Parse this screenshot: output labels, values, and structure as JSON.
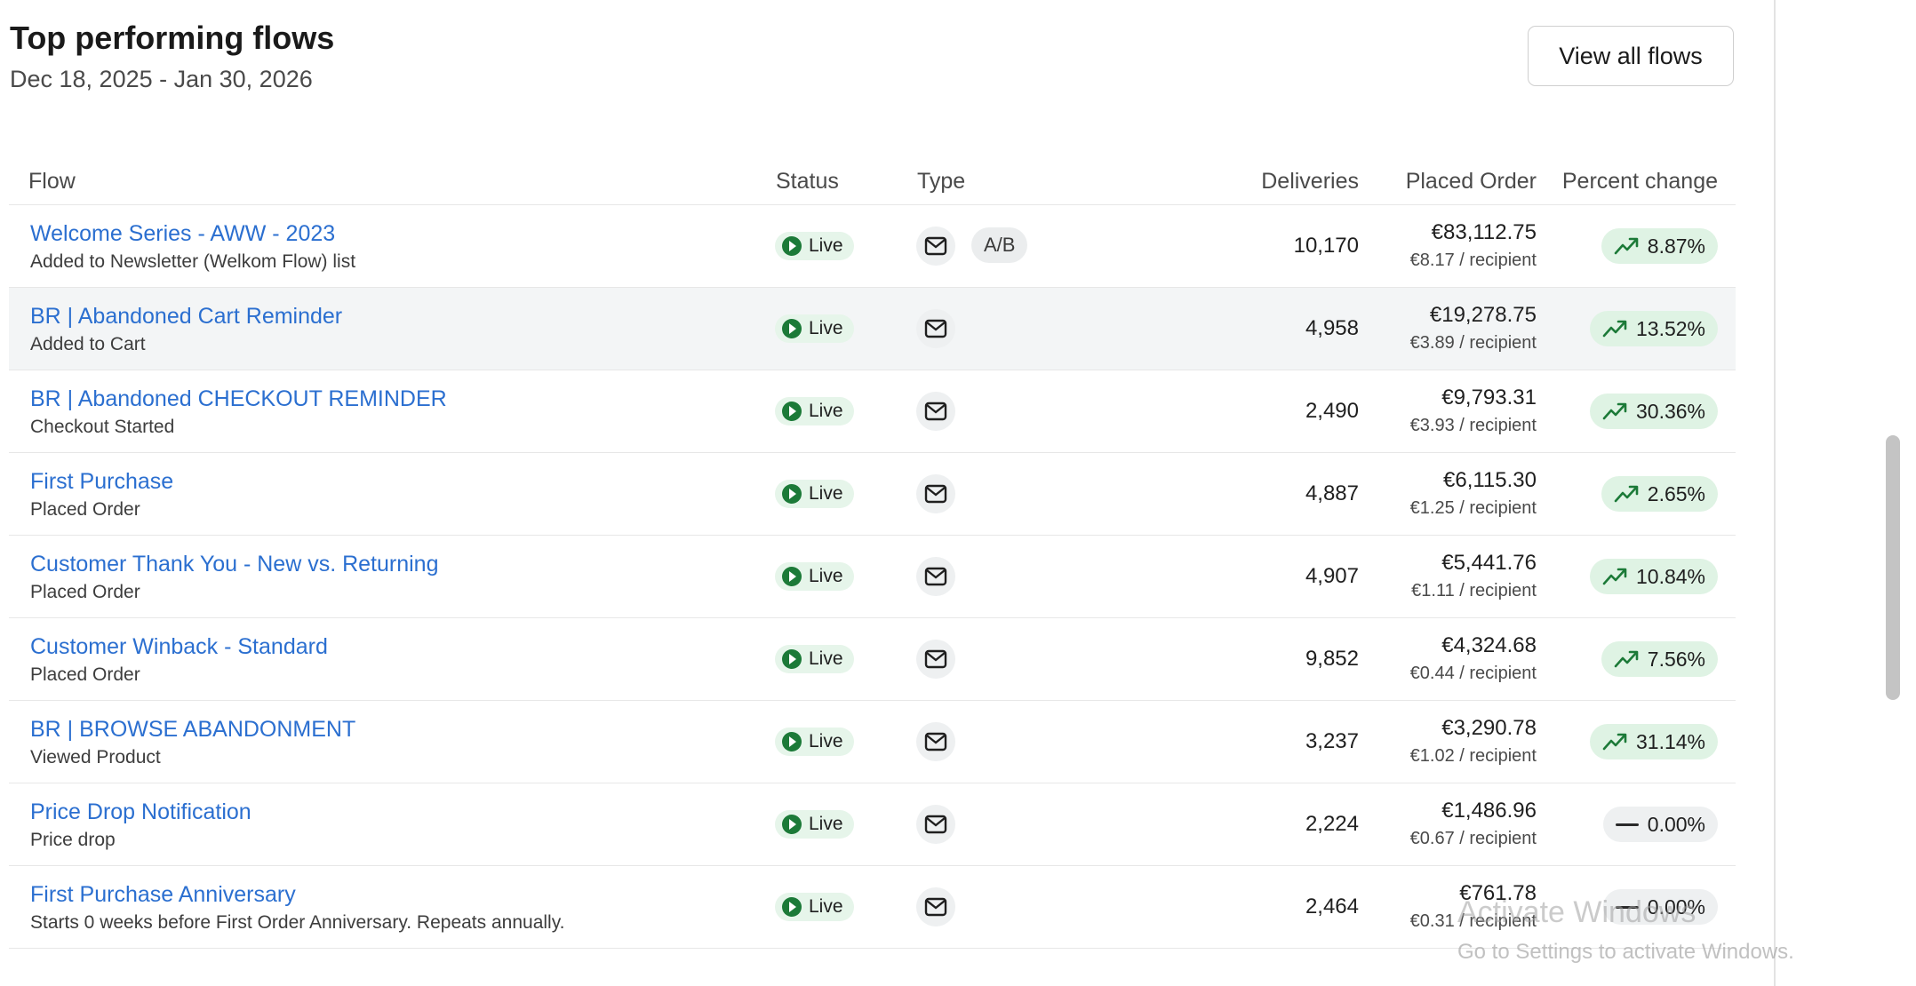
{
  "header": {
    "title": "Top performing flows",
    "date_range": "Dec 18, 2025 - Jan 30, 2026",
    "view_all_label": "View all flows"
  },
  "columns": {
    "flow": "Flow",
    "status": "Status",
    "type": "Type",
    "deliveries": "Deliveries",
    "placed_order": "Placed Order",
    "percent_change": "Percent change"
  },
  "rows": [
    {
      "name": "Welcome Series - AWW - 2023",
      "trigger": "Added to Newsletter (Welkom Flow) list",
      "status": "Live",
      "type_icon": "mail-icon",
      "ab": "A/B",
      "deliveries": "10,170",
      "placed": "€83,112.75",
      "per_recipient": "€8.17 / recipient",
      "change": "8.87%",
      "trend": "up"
    },
    {
      "name": "BR | Abandoned Cart Reminder",
      "trigger": "Added to Cart",
      "status": "Live",
      "type_icon": "mail-icon",
      "ab": "",
      "deliveries": "4,958",
      "placed": "€19,278.75",
      "per_recipient": "€3.89 / recipient",
      "change": "13.52%",
      "trend": "up"
    },
    {
      "name": "BR | Abandoned CHECKOUT REMINDER",
      "trigger": "Checkout Started",
      "status": "Live",
      "type_icon": "mail-icon",
      "ab": "",
      "deliveries": "2,490",
      "placed": "€9,793.31",
      "per_recipient": "€3.93 / recipient",
      "change": "30.36%",
      "trend": "up"
    },
    {
      "name": "First Purchase",
      "trigger": "Placed Order",
      "status": "Live",
      "type_icon": "mail-icon",
      "ab": "",
      "deliveries": "4,887",
      "placed": "€6,115.30",
      "per_recipient": "€1.25 / recipient",
      "change": "2.65%",
      "trend": "up"
    },
    {
      "name": "Customer Thank You - New vs. Returning",
      "trigger": "Placed Order",
      "status": "Live",
      "type_icon": "mail-icon",
      "ab": "",
      "deliveries": "4,907",
      "placed": "€5,441.76",
      "per_recipient": "€1.11 / recipient",
      "change": "10.84%",
      "trend": "up"
    },
    {
      "name": "Customer Winback - Standard",
      "trigger": "Placed Order",
      "status": "Live",
      "type_icon": "mail-icon",
      "ab": "",
      "deliveries": "9,852",
      "placed": "€4,324.68",
      "per_recipient": "€0.44 / recipient",
      "change": "7.56%",
      "trend": "up"
    },
    {
      "name": "BR | BROWSE ABANDONMENT",
      "trigger": "Viewed Product",
      "status": "Live",
      "type_icon": "mail-icon",
      "ab": "",
      "deliveries": "3,237",
      "placed": "€3,290.78",
      "per_recipient": "€1.02 / recipient",
      "change": "31.14%",
      "trend": "up"
    },
    {
      "name": "Price Drop Notification",
      "trigger": "Price drop",
      "status": "Live",
      "type_icon": "mail-icon",
      "ab": "",
      "deliveries": "2,224",
      "placed": "€1,486.96",
      "per_recipient": "€0.67 / recipient",
      "change": "0.00%",
      "trend": "flat"
    },
    {
      "name": "First Purchase Anniversary",
      "trigger": "Starts 0 weeks before First Order Anniversary. Repeats annually.",
      "status": "Live",
      "type_icon": "mail-icon",
      "ab": "",
      "deliveries": "2,464",
      "placed": "€761.78",
      "per_recipient": "€0.31 / recipient",
      "change": "0.00%",
      "trend": "flat"
    }
  ],
  "watermark": {
    "line1": "Activate Windows",
    "line2": "Go to Settings to activate Windows."
  },
  "colors": {
    "link": "#2b6fd0",
    "live_bg": "#e6f5ea",
    "live_icon": "#1c7a38",
    "up_bg": "#dff3e4",
    "up_icon": "#1c7a38",
    "flat_bg": "#eef0f1"
  }
}
